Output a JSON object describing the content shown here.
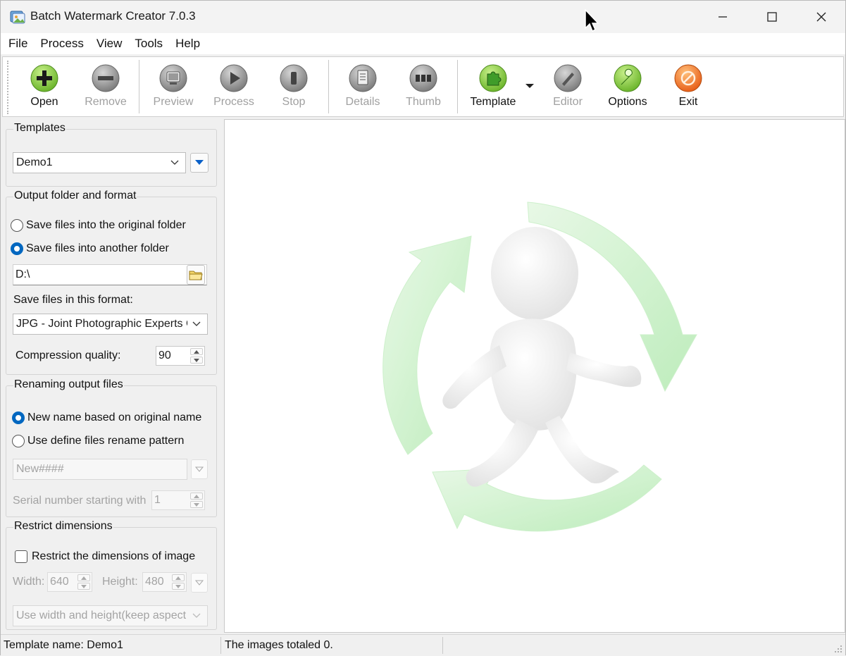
{
  "window": {
    "title": "Batch Watermark Creator 7.0.3"
  },
  "menu": [
    "File",
    "Process",
    "View",
    "Tools",
    "Help"
  ],
  "toolbar": {
    "buttons": [
      {
        "label": "Open",
        "icon": "plus-icon",
        "enabled": true,
        "color": "#7cc639"
      },
      {
        "label": "Remove",
        "icon": "minus-icon",
        "enabled": false,
        "color": "#8a8a8a"
      },
      {
        "label": "Preview",
        "icon": "preview-icon",
        "enabled": false,
        "color": "#8a8a8a"
      },
      {
        "label": "Process",
        "icon": "play-icon",
        "enabled": false,
        "color": "#8a8a8a"
      },
      {
        "label": "Stop",
        "icon": "stop-icon",
        "enabled": false,
        "color": "#8a8a8a"
      },
      {
        "label": "Details",
        "icon": "details-icon",
        "enabled": false,
        "color": "#8a8a8a"
      },
      {
        "label": "Thumb",
        "icon": "thumb-icon",
        "enabled": false,
        "color": "#8a8a8a"
      },
      {
        "label": "Template",
        "icon": "puzzle-icon",
        "enabled": true,
        "color": "#7cc639"
      },
      {
        "label": "Editor",
        "icon": "pencil-icon",
        "enabled": false,
        "color": "#8a8a8a"
      },
      {
        "label": "Options",
        "icon": "wrench-icon",
        "enabled": true,
        "color": "#8fd13b"
      },
      {
        "label": "Exit",
        "icon": "exit-icon",
        "enabled": true,
        "color": "#f07a2a"
      }
    ]
  },
  "templates": {
    "title": "Templates",
    "selected": "Demo1"
  },
  "output": {
    "title": "Output folder and format",
    "radio_original": "Save files into the original folder",
    "radio_another": "Save files into another folder",
    "selected": "another",
    "folder": "D:\\",
    "format_label": "Save files in this format:",
    "format_value": "JPG - Joint Photographic Experts Group",
    "compression_label": "Compression quality:",
    "compression_value": "90"
  },
  "rename": {
    "title": "Renaming output files",
    "radio_original": "New name based on original name",
    "radio_pattern": "Use define files rename pattern",
    "selected": "original",
    "pattern": "New####",
    "serial_label": "Serial number starting with",
    "serial_value": "1"
  },
  "restrict": {
    "title": "Restrict dimensions",
    "checkbox_label": "Restrict the dimensions of image",
    "checked": false,
    "width_label": "Width:",
    "width_value": "640",
    "height_label": "Height:",
    "height_value": "480",
    "mode": "Use width and height(keep aspect ratio)"
  },
  "status": {
    "template": "Template name: Demo1",
    "images": "The images totaled 0."
  },
  "colors": {
    "accent": "#0067c0",
    "preview_bg": "#ffffff",
    "arrow_green": "#bfeec0"
  }
}
